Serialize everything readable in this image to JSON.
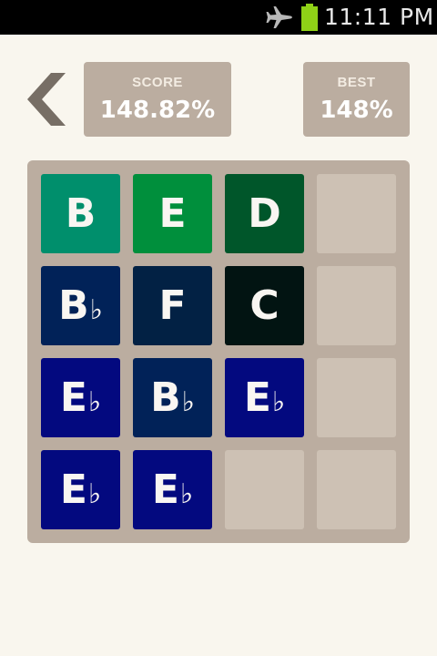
{
  "status_bar": {
    "time": "11:11 PM",
    "icons": [
      "airplane-mode-icon",
      "battery-icon"
    ],
    "battery_color": "#8fd117"
  },
  "header": {
    "back_icon": "chevron-left-icon",
    "score": {
      "label": "SCORE",
      "value": "148.82%"
    },
    "best": {
      "label": "BEST",
      "value": "148%"
    }
  },
  "colors": {
    "page_background": "#f9f6ee",
    "board_background": "#bbada0",
    "empty_cell": "#cdc1b4",
    "tile_text": "#f9f6f2"
  },
  "board": {
    "rows": 4,
    "cols": 4,
    "tiles": [
      [
        {
          "note": "B",
          "accidental": "",
          "color": "#008f6c"
        },
        {
          "note": "E",
          "accidental": "",
          "color": "#008f3c"
        },
        {
          "note": "D",
          "accidental": "",
          "color": "#00562a"
        },
        null
      ],
      [
        {
          "note": "B",
          "accidental": "♭",
          "color": "#012258"
        },
        {
          "note": "F",
          "accidental": "",
          "color": "#022144"
        },
        {
          "note": "C",
          "accidental": "",
          "color": "#021412"
        },
        null
      ],
      [
        {
          "note": "E",
          "accidental": "♭",
          "color": "#03097f"
        },
        {
          "note": "B",
          "accidental": "♭",
          "color": "#012258"
        },
        {
          "note": "E",
          "accidental": "♭",
          "color": "#03097f"
        },
        null
      ],
      [
        {
          "note": "E",
          "accidental": "♭",
          "color": "#03097f"
        },
        {
          "note": "E",
          "accidental": "♭",
          "color": "#03097f"
        },
        null,
        null
      ]
    ]
  }
}
